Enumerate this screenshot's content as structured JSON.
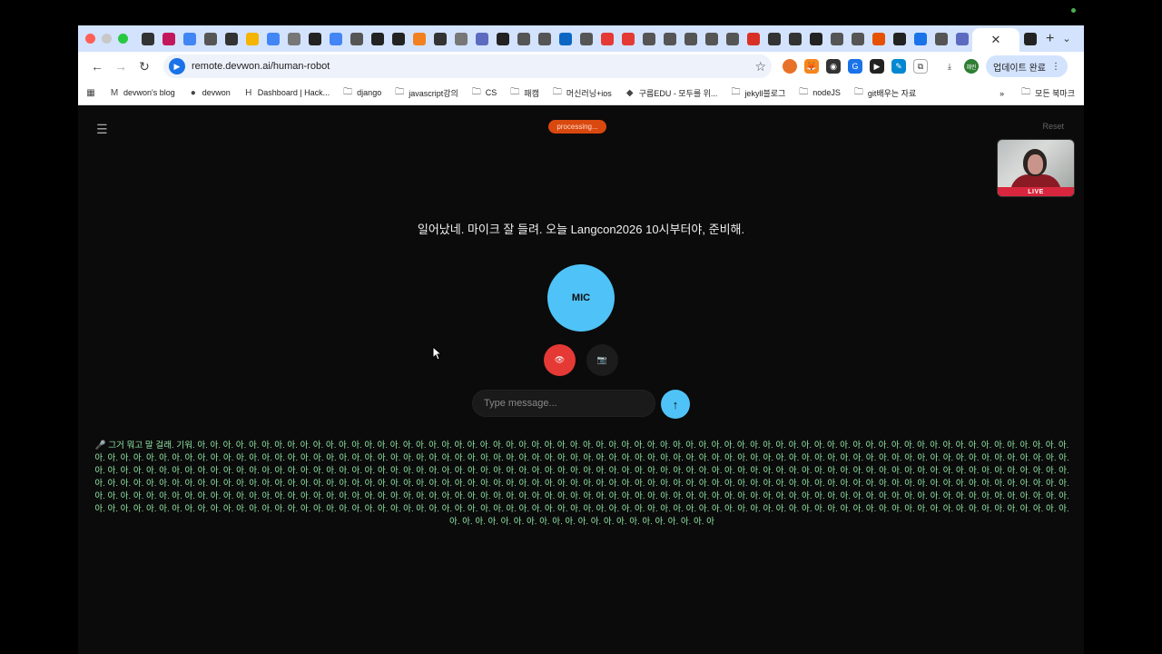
{
  "browser": {
    "tabs": [
      {
        "icon": "perplexity-icon",
        "color": "#333"
      },
      {
        "icon": "app-icon",
        "color": "#c2185b"
      },
      {
        "icon": "cloud-icon",
        "color": "#4285f4"
      },
      {
        "icon": "globe-icon",
        "color": "#555"
      },
      {
        "icon": "perplexity-icon",
        "color": "#333"
      },
      {
        "icon": "slides-icon",
        "color": "#f4b400"
      },
      {
        "icon": "cloud-icon",
        "color": "#4285f4"
      },
      {
        "icon": "gear-icon",
        "color": "#777"
      },
      {
        "icon": "terminal-icon",
        "color": "#222"
      },
      {
        "icon": "cloud-icon",
        "color": "#4285f4"
      },
      {
        "icon": "chrome-icon",
        "color": "#555"
      },
      {
        "icon": "github-icon",
        "color": "#222"
      },
      {
        "icon": "github-icon",
        "color": "#222"
      },
      {
        "icon": "cloudflare-icon",
        "color": "#f38020"
      },
      {
        "icon": "perplexity-icon",
        "color": "#333"
      },
      {
        "icon": "gear-icon",
        "color": "#777"
      },
      {
        "icon": "api-icon",
        "color": "#5c6bc0"
      },
      {
        "icon": "terminal-icon",
        "color": "#222"
      },
      {
        "icon": "chrome-icon",
        "color": "#555"
      },
      {
        "icon": "chrome-icon",
        "color": "#555"
      },
      {
        "icon": "linkedin-icon",
        "color": "#0a66c2"
      },
      {
        "icon": "chrome-icon",
        "color": "#555"
      },
      {
        "icon": "youtube-icon",
        "color": "#e53935"
      },
      {
        "icon": "youtube-icon",
        "color": "#e53935"
      },
      {
        "icon": "globe-icon",
        "color": "#555"
      },
      {
        "icon": "globe-icon",
        "color": "#555"
      },
      {
        "icon": "globe-icon",
        "color": "#555"
      },
      {
        "icon": "chrome-icon",
        "color": "#555"
      },
      {
        "icon": "chrome-icon",
        "color": "#555"
      },
      {
        "icon": "gmail-icon",
        "color": "#d93025"
      },
      {
        "icon": "perplexity-icon",
        "color": "#333"
      },
      {
        "icon": "perplexity-icon",
        "color": "#333"
      },
      {
        "icon": "github-icon",
        "color": "#222"
      },
      {
        "icon": "globe-icon",
        "color": "#555"
      },
      {
        "icon": "globe-icon",
        "color": "#555"
      },
      {
        "icon": "sparkle-icon",
        "color": "#e65100"
      },
      {
        "icon": "terminal-icon",
        "color": "#222"
      },
      {
        "icon": "shield-icon",
        "color": "#1a73e8"
      },
      {
        "icon": "globe-icon",
        "color": "#555"
      },
      {
        "icon": "api-icon",
        "color": "#5c6bc0"
      }
    ],
    "active_tab_icon": "github-icon",
    "url": "remote.devwon.ai/human-robot",
    "update_label": "업데이트 완료",
    "profile_label": "혜린",
    "bookmarks": [
      {
        "label": "devwon's blog",
        "icon": "medium-icon"
      },
      {
        "label": "devwon",
        "icon": "github-icon"
      },
      {
        "label": "Dashboard | Hack...",
        "icon": "hackerrank-icon"
      },
      {
        "label": "django",
        "icon": "folder-icon"
      },
      {
        "label": "javascript강의",
        "icon": "folder-icon"
      },
      {
        "label": "CS",
        "icon": "folder-icon"
      },
      {
        "label": "패캠",
        "icon": "folder-icon"
      },
      {
        "label": "머신러닝+ios",
        "icon": "folder-icon"
      },
      {
        "label": "구름EDU - 모두를 위...",
        "icon": "goorm-icon"
      },
      {
        "label": "jekyll블로그",
        "icon": "folder-icon"
      },
      {
        "label": "nodeJS",
        "icon": "folder-icon"
      },
      {
        "label": "git배우는 자료",
        "icon": "folder-icon"
      }
    ],
    "all_bookmarks_label": "모든 북마크"
  },
  "app": {
    "status": "processing...",
    "reset_label": "Reset",
    "live_label": "LIVE",
    "speech_text": "일어났네. 마이크 잘 들려. 오늘 Langcon2026 10시부터야, 준비해.",
    "mic_label": "MIC",
    "eye_button_glyph": "👁",
    "camera_button_glyph": "📷",
    "message_placeholder": "Type message...",
    "send_glyph": "↑",
    "transcript": "🎤 그거 뭐고 말 걸래. 기워. 아. 아. 아. 아. 아. 아. 아. 아. 아. 아. 아. 아. 아. 아. 아. 아. 아. 아. 아. 아. 아. 아. 아. 아. 아. 아. 아. 아. 아. 아. 아. 아. 아. 아. 아. 아. 아. 아. 아. 아. 아. 아. 아. 아. 아. 아. 아. 아. 아. 아. 아. 아. 아. 아. 아. 아. 아. 아. 아. 아. 아. 아. 아. 아. 아. 아. 아. 아. 아. 아. 아. 아. 아. 아. 아. 아. 아. 아. 아. 아. 아. 아. 아. 아. 아. 아. 아. 아. 아. 아. 아. 아. 아. 아. 아. 아. 아. 아. 아. 아. 아. 아. 아. 아. 아. 아. 아. 아. 아. 아. 아. 아. 아. 아. 아. 아. 아. 아. 아. 아. 아. 아. 아. 아. 아. 아. 아. 아. 아. 아. 아. 아. 아. 아. 아. 아. 아. 아. 아. 아. 아. 아. 아. 아. 아. 아. 아. 아. 아. 아. 아. 아. 아. 아. 아. 아. 아. 아. 아. 아. 아. 아. 아. 아. 아. 아. 아. 아. 아. 아. 아. 아. 아. 아. 아. 아. 아. 아. 아. 아. 아. 아. 아. 아. 아. 아. 아. 아. 아. 아. 아. 아. 아. 아. 아. 아. 아. 아. 아. 아. 아. 아. 아. 아. 아. 아. 아. 아. 아. 아. 아. 아. 아. 아. 아. 아. 아. 아. 아. 아. 아. 아. 아. 아. 아. 아. 아. 아. 아. 아. 아. 아. 아. 아. 아. 아. 아. 아. 아. 아. 아. 아. 아. 아. 아. 아. 아. 아. 아. 아. 아. 아. 아. 아. 아. 아. 아. 아. 아. 아. 아. 아. 아. 아. 아. 아. 아. 아. 아. 아. 아. 아. 아. 아. 아. 아. 아. 아. 아. 아. 아. 아. 아. 아. 아. 아. 아. 아. 아. 아. 아. 아. 아. 아. 아. 아. 아. 아. 아. 아. 아. 아. 아. 아. 아. 아. 아. 아. 아. 아. 아. 아. 아. 아. 아. 아. 아. 아. 아. 아. 아. 아. 아. 아. 아. 아. 아. 아. 아. 아. 아. 아. 아. 아. 아. 아. 아. 아. 아. 아. 아. 아. 아. 아. 아. 아. 아. 아. 아. 아. 아. 아. 아. 아. 아. 아. 아. 아. 아. 아. 아. 아. 아. 아. 아. 아. 아. 아. 아. 아. 아. 아. 아. 아. 아. 아. 아. 아. 아. 아. 아. 아. 아. 아. 아. 아. 아. 아. 아. 아. 아. 아. 아. 아. 아. 아. 아. 아. 아. 아. 아. 아. 아. 아. 아. 아. 아. 아. 아. 아. 아. 아. 아. 아. 아. 아. 아. 아. 아. 아. 아. 아. 아. 아. 아. 아. 아. 아. 아. 아. 아. 아. 아. 아. 아. 아. 아. 아. 아. 아. 아. 아. 아. 아. 아. 아. 아. 아. 아. 아. 아. 아. 아. 아. 아. 아. 아. 아. 아. 아. 아. 아. 아. 아. 아. 아. 아. 아. 아",
    "colors": {
      "accent": "#4fc3f7",
      "status": "#d9480f",
      "record": "#e53935",
      "transcript": "#8fe3a3"
    }
  }
}
